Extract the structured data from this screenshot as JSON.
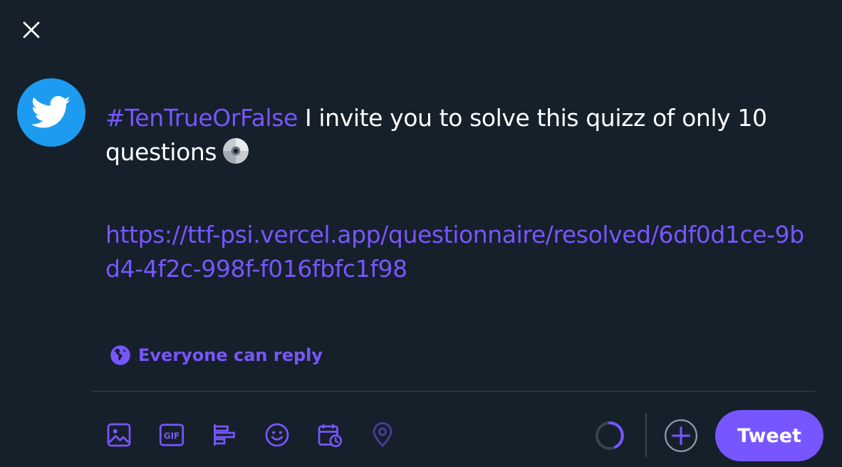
{
  "compose": {
    "hashtag": "#TenTrueOrFalse",
    "text_line": " I invite you to solve this quizz of only 10 questions",
    "emoji": "💿",
    "link": " https://ttf-psi.vercel.app/questionnaire/resolved/6df0d1ce-9bd4-4f2c-998f-f016fbfc1f98"
  },
  "reply_setting": {
    "label": "Everyone can reply",
    "icon": "globe-icon"
  },
  "toolbar": {
    "icons": [
      "image-icon",
      "gif-icon",
      "poll-icon",
      "emoji-icon",
      "schedule-icon",
      "location-icon"
    ],
    "gif_text": "GIF"
  },
  "actions": {
    "tweet_label": "Tweet"
  },
  "colors": {
    "background": "#15202b",
    "accent": "#7856ff",
    "avatar": "#1d9bf0",
    "divider": "#38444d"
  }
}
